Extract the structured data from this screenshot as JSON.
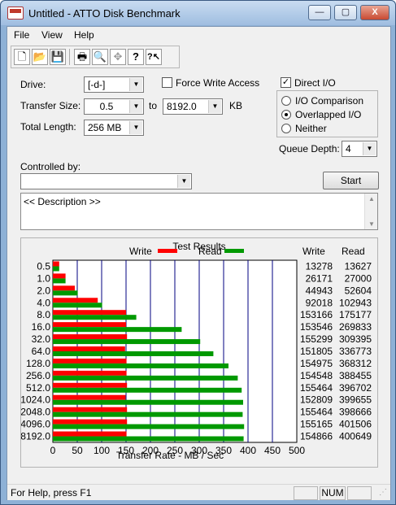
{
  "window": {
    "title": "Untitled - ATTO Disk Benchmark",
    "minimize": "—",
    "maximize": "▢",
    "close": "X"
  },
  "menu": [
    "File",
    "View",
    "Help"
  ],
  "toolbar": {
    "new": "🗋",
    "open": "📂",
    "save": "💾",
    "print": "🖶",
    "preview": "🔍",
    "move": "✥",
    "help": "?",
    "context_help": "?↖"
  },
  "form": {
    "drive_label": "Drive:",
    "drive_value": "[-d-]",
    "force_write_label": "Force Write Access",
    "force_write_checked": false,
    "direct_io_label": "Direct I/O",
    "direct_io_checked": true,
    "transfer_size_label": "Transfer Size:",
    "transfer_from": "0.5",
    "to_label": "to",
    "transfer_to": "8192.0",
    "kb_label": "KB",
    "total_length_label": "Total Length:",
    "total_length_value": "256 MB",
    "io_comparison_label": "I/O Comparison",
    "overlapped_io_label": "Overlapped I/O",
    "neither_label": "Neither",
    "io_mode_selected": "overlapped",
    "queue_depth_label": "Queue Depth:",
    "queue_depth_value": "4",
    "controlled_by_label": "Controlled by:",
    "controlled_by_value": "",
    "start_label": "Start",
    "description": "<< Description >>"
  },
  "results": {
    "group_title": "Test Results",
    "write_legend": "Write",
    "read_legend": "Read",
    "write_col": "Write",
    "read_col": "Read",
    "write_color": "#ff0000",
    "read_color": "#009900"
  },
  "chart_data": {
    "type": "bar",
    "orientation": "horizontal",
    "title": "Test Results",
    "xlabel": "Transfer Rate - MB / Sec",
    "ylabel": "",
    "xlim": [
      0,
      500
    ],
    "xticks": [
      "0",
      "50",
      "100",
      "150",
      "200",
      "250",
      "300",
      "350",
      "400",
      "450",
      "500"
    ],
    "grid": true,
    "legend": "top",
    "categories": [
      "0.5",
      "1.0",
      "2.0",
      "4.0",
      "8.0",
      "16.0",
      "32.0",
      "64.0",
      "128.0",
      "256.0",
      "512.0",
      "1024.0",
      "2048.0",
      "4096.0",
      "8192.0"
    ],
    "series": [
      {
        "name": "Write",
        "color": "#ff0000",
        "units": "MB/s",
        "values": [
          13,
          26,
          45,
          92,
          150,
          150,
          152,
          148,
          151,
          151,
          152,
          149,
          152,
          152,
          151
        ],
        "labels": [
          "13278",
          "26171",
          "44943",
          "92018",
          "153166",
          "153546",
          "155299",
          "151805",
          "154975",
          "154548",
          "155464",
          "152809",
          "155464",
          "155165",
          "154866"
        ]
      },
      {
        "name": "Read",
        "color": "#009900",
        "units": "MB/s",
        "values": [
          13,
          26,
          51,
          101,
          171,
          264,
          302,
          329,
          360,
          379,
          387,
          390,
          389,
          392,
          391
        ],
        "labels": [
          "13627",
          "27000",
          "52604",
          "102943",
          "175177",
          "269833",
          "309395",
          "336773",
          "368312",
          "388455",
          "396702",
          "399655",
          "398666",
          "401506",
          "400649"
        ]
      }
    ]
  },
  "status": {
    "help_text": "For Help, press F1",
    "panel_empty": "",
    "num": "NUM",
    "panel_last": ""
  }
}
